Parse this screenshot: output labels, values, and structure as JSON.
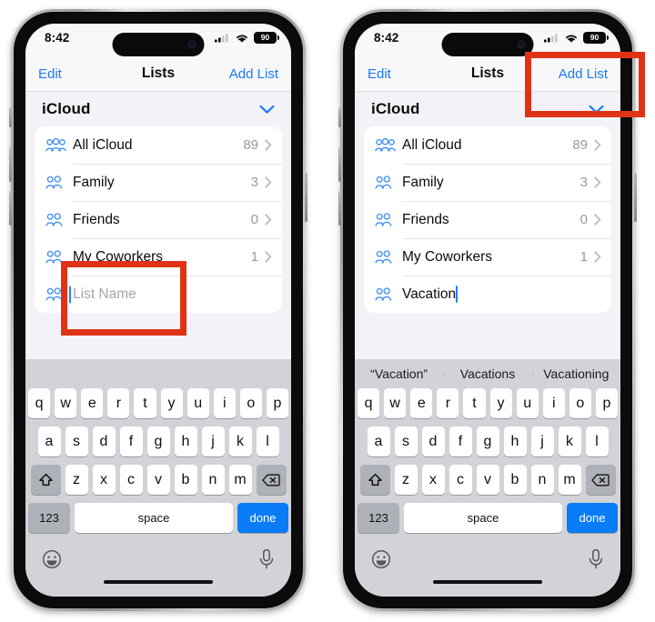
{
  "meta": {
    "accent_blue": "#1a7af8",
    "annotation_red": "#e03316",
    "screen_bg": "#f2f2f7",
    "keyboard_bg": "#d1d3d9"
  },
  "status_bar": {
    "time": "8:42",
    "cellular_icon": "cellular-signal-icon",
    "wifi_icon": "wifi-icon",
    "battery_level": "90",
    "battery_icon": "battery-icon"
  },
  "nav_bar": {
    "left_label": "Edit",
    "title": "Lists",
    "right_label": "Add List"
  },
  "account_header": {
    "title": "iCloud",
    "chevron_icon": "chevron-down-icon"
  },
  "lists": [
    {
      "icon": "three-people-icon",
      "label": "All iCloud",
      "count": "89",
      "chevron": "chevron-right-icon"
    },
    {
      "icon": "two-people-icon",
      "label": "Family",
      "count": "3",
      "chevron": "chevron-right-icon"
    },
    {
      "icon": "two-people-icon",
      "label": "Friends",
      "count": "0",
      "chevron": "chevron-right-icon"
    },
    {
      "icon": "two-people-icon",
      "label": "My Coworkers",
      "count": "1",
      "chevron": "chevron-right-icon"
    }
  ],
  "left_phone": {
    "new_list_row": {
      "icon": "two-people-icon",
      "placeholder": "List Name",
      "value": ""
    },
    "suggestions": [
      "",
      "",
      ""
    ],
    "annotation": {
      "target": "list-name-input",
      "shape": "rectangle"
    }
  },
  "right_phone": {
    "new_list_row": {
      "icon": "two-people-icon",
      "placeholder": "List Name",
      "value": "Vacation"
    },
    "suggestions": [
      "“Vacation”",
      "Vacations",
      "Vacationing"
    ],
    "annotation": {
      "target": "add-list-button",
      "shape": "rectangle"
    }
  },
  "keyboard": {
    "row1": [
      "q",
      "w",
      "e",
      "r",
      "t",
      "y",
      "u",
      "i",
      "o",
      "p"
    ],
    "row2": [
      "a",
      "s",
      "d",
      "f",
      "g",
      "h",
      "j",
      "k",
      "l"
    ],
    "row3": [
      "z",
      "x",
      "c",
      "v",
      "b",
      "n",
      "m"
    ],
    "shift_icon": "shift-up-arrow-icon",
    "backspace_icon": "backspace-delete-icon",
    "numbers_label": "123",
    "space_label": "space",
    "return_label": "done",
    "emoji_icon": "emoji-smiley-icon",
    "dictation_icon": "microphone-icon"
  }
}
